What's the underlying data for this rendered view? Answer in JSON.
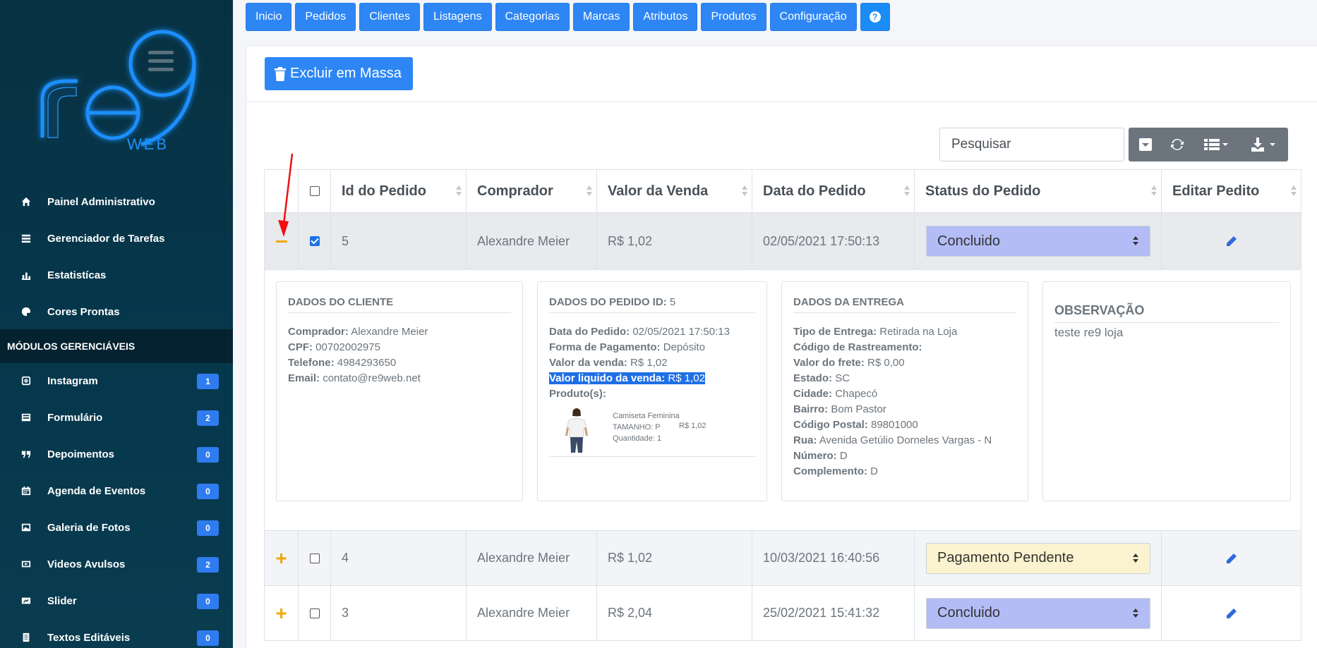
{
  "sidebar": {
    "logo_text": "re9",
    "logo_sub": "WEB",
    "items": [
      {
        "label": "Painel Administrativo",
        "icon": "home-icon"
      },
      {
        "label": "Gerenciador de Tarefas",
        "icon": "tasks-icon"
      },
      {
        "label": "Estatistícas",
        "icon": "chart-icon"
      },
      {
        "label": "Cores Prontas",
        "icon": "palette-icon"
      }
    ],
    "modules_header": "MÓDULOS GERENCIÁVEIS",
    "modules": [
      {
        "label": "Instagram",
        "icon": "instagram-icon",
        "count": "1"
      },
      {
        "label": "Formulário",
        "icon": "form-icon",
        "count": "2"
      },
      {
        "label": "Depoimentos",
        "icon": "quote-icon",
        "count": "0"
      },
      {
        "label": "Agenda de Eventos",
        "icon": "calendar-icon",
        "count": "0"
      },
      {
        "label": "Galeria de Fotos",
        "icon": "image-icon",
        "count": "0"
      },
      {
        "label": "Videos Avulsos",
        "icon": "video-icon",
        "count": "2"
      },
      {
        "label": "Slider",
        "icon": "slider-icon",
        "count": "0"
      },
      {
        "label": "Textos Editáveis",
        "icon": "text-icon",
        "count": "0"
      }
    ]
  },
  "topnav": [
    "Inicio",
    "Pedidos",
    "Clientes",
    "Listagens",
    "Categorias",
    "Marcas",
    "Atributos",
    "Produtos",
    "Configuração"
  ],
  "help_label": "?",
  "toolbar": {
    "mass_delete": "Excluir em Massa",
    "search_placeholder": "Pesquisar"
  },
  "table": {
    "headers": [
      "Id do Pedido",
      "Comprador",
      "Valor da Venda",
      "Data do Pedido",
      "Status do Pedido",
      "Editar Pedito"
    ],
    "rows": [
      {
        "id": "5",
        "buyer": "Alexandre Meier",
        "value": "R$ 1,02",
        "date": "02/05/2021 17:50:13",
        "status": "Concluido",
        "status_color": "#b3bcf5",
        "expanded": true,
        "checked": true
      },
      {
        "id": "4",
        "buyer": "Alexandre Meier",
        "value": "R$ 1,02",
        "date": "10/03/2021 16:40:56",
        "status": "Pagamento Pendente",
        "status_color": "#fbf3cf",
        "expanded": false,
        "checked": false
      },
      {
        "id": "3",
        "buyer": "Alexandre Meier",
        "value": "R$ 2,04",
        "date": "25/02/2021 15:41:32",
        "status": "Concluido",
        "status_color": "#b3bcf5",
        "expanded": false,
        "checked": false
      }
    ]
  },
  "detail": {
    "cliente": {
      "title": "DADOS DO CLIENTE",
      "lines": [
        {
          "k": "Comprador:",
          "v": "Alexandre Meier"
        },
        {
          "k": "CPF:",
          "v": "00702002975"
        },
        {
          "k": "Telefone:",
          "v": "4984293650"
        },
        {
          "k": "Email:",
          "v": "contato@re9web.net"
        }
      ]
    },
    "pedido": {
      "title": "DADOS DO PEDIDO ID:",
      "id": "5",
      "lines": [
        {
          "k": "Data do Pedido:",
          "v": "02/05/2021 17:50:13"
        },
        {
          "k": "Forma de Pagamento:",
          "v": "Depósito"
        },
        {
          "k": "Valor da venda:",
          "v": "R$ 1,02"
        }
      ],
      "highlight": {
        "k": "Valor liquido da venda:",
        "v": "R$ 1,02"
      },
      "products_label": "Produto(s):",
      "product": {
        "name": "Camiseta Feminina",
        "size": "TAMANHO: P",
        "qty": "Quantidade: 1",
        "price": "R$ 1,02"
      }
    },
    "entrega": {
      "title": "DADOS DA ENTREGA",
      "lines": [
        {
          "k": "Tipo de Entrega:",
          "v": "Retirada na Loja"
        },
        {
          "k": "Código de Rastreamento:",
          "v": ""
        },
        {
          "k": "Valor do frete:",
          "v": "R$ 0,00"
        },
        {
          "k": "Estado:",
          "v": "SC"
        },
        {
          "k": "Cidade:",
          "v": "Chapecó"
        },
        {
          "k": "Bairro:",
          "v": "Bom Pastor"
        },
        {
          "k": "Código Postal:",
          "v": "89801000"
        },
        {
          "k": "Rua:",
          "v": "Avenida Getúlio Dorneles Vargas - N"
        },
        {
          "k": "Número:",
          "v": "D"
        },
        {
          "k": "Complemento:",
          "v": "D"
        }
      ]
    },
    "obs": {
      "title": "OBSERVAÇÃO",
      "text": "teste re9 loja"
    }
  }
}
